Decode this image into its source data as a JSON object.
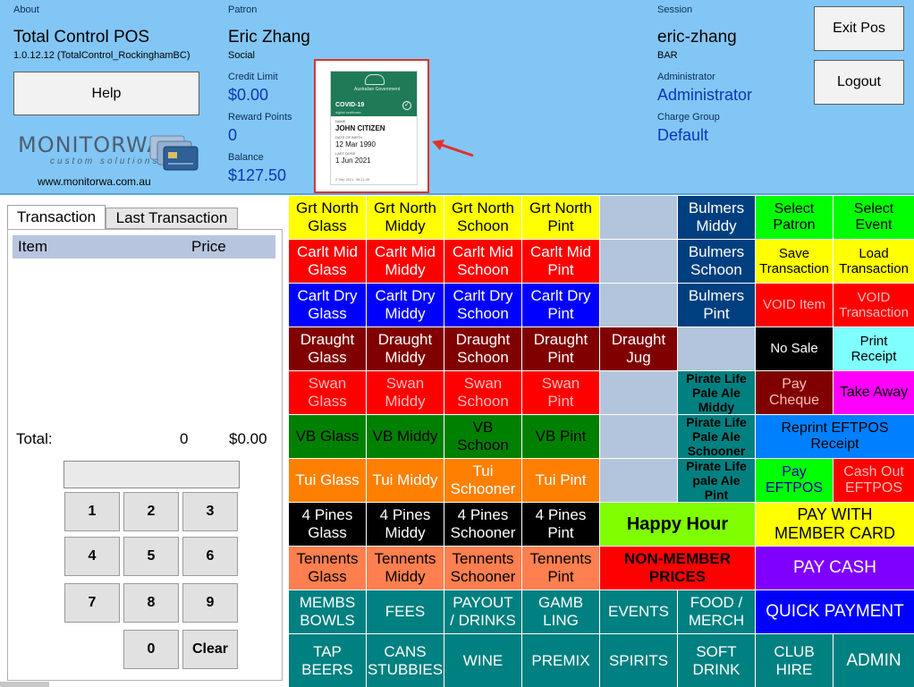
{
  "header": {
    "about_label": "About",
    "app_name": "Total Control POS",
    "version": "1.0.12.12  (TotalControl_RockinghamBC)",
    "help_label": "Help",
    "logo_text": "MONITORWA",
    "logo_sub": "custom solutions",
    "site_url": "www.monitorwa.com.au",
    "patron_label": "Patron",
    "patron_name": "Eric Zhang",
    "patron_type": "Social",
    "credit_limit_label": "Credit Limit",
    "credit_limit": "$0.00",
    "reward_points_label": "Reward Points",
    "reward_points": "0",
    "balance_label": "Balance",
    "balance": "$127.50",
    "session_label": "Session",
    "session_user": "eric-zhang",
    "session_location": "BAR",
    "administrator_label": "Administrator",
    "administrator": "Administrator",
    "charge_group_label": "Charge Group",
    "charge_group": "Default",
    "exit_pos_label": "Exit Pos",
    "logout_label": "Logout"
  },
  "id_card": {
    "gov_text": "Australian Government",
    "title": "COVID-19",
    "subtitle": "digital certificate",
    "name_label": "NAME",
    "name": "JOHN CITIZEN",
    "dob_label": "DATE OF BIRTH",
    "dob": "12 Mar 1990",
    "last_dose_label": "LAST DOSE",
    "last_dose": "1 Jun 2021",
    "footer": "2 Sep 2021, 08:21:39"
  },
  "transaction": {
    "tabs": [
      "Transaction",
      "Last Transaction"
    ],
    "col_item": "Item",
    "col_price": "Price",
    "total_label": "Total:",
    "total_qty": "0",
    "total_value": "$0.00",
    "keys": [
      "1",
      "2",
      "3",
      "4",
      "5",
      "6",
      "7",
      "8",
      "9",
      "0",
      "Clear"
    ]
  },
  "colors": {
    "yellow": "#ffff00",
    "red": "#ff0000",
    "blue": "#0000ff",
    "maroon": "#800000",
    "green": "#008000",
    "orange": "#ff8000",
    "black": "#000000",
    "salmon": "#ff7f50",
    "teal": "#008080",
    "navy": "#003f7f",
    "empty": "#b3c5dc",
    "lime": "#7fff00",
    "bright_green": "#00ff00",
    "cyan": "#7fffff",
    "magenta": "#ff00ff",
    "purple": "#8000ff",
    "royal": "#0000ff",
    "sky": "#0080ff"
  },
  "grid": {
    "rows": [
      [
        "Grt North\nGlass",
        "Grt North\nMiddy",
        "Grt North\nSchoon",
        "Grt North\nPint",
        "",
        "Bulmers\nMiddy",
        "Select\nPatron",
        "Select\nEvent"
      ],
      [
        "Carlt Mid\nGlass",
        "Carlt Mid\nMiddy",
        "Carlt Mid\nSchoon",
        "Carlt Mid\nPint",
        "",
        "Bulmers\nSchoon",
        "Save\nTransaction",
        "Load\nTransaction"
      ],
      [
        "Carlt Dry\nGlass",
        "Carlt Dry\nMiddy",
        "Carlt Dry\nSchoon",
        "Carlt Dry\nPint",
        "",
        "Bulmers\nPint",
        "VOID Item",
        "VOID\nTransaction"
      ],
      [
        "Draught\nGlass",
        "Draught\nMiddy",
        "Draught\nSchoon",
        "Draught\nPint",
        "Draught\nJug",
        "",
        "No Sale",
        "Print\nReceipt"
      ],
      [
        "Swan\nGlass",
        "Swan\nMiddy",
        "Swan\nSchoon",
        "Swan\nPint",
        "",
        "Pirate Life\nPale Ale\nMiddy",
        "Pay\nCheque",
        "Take Away"
      ],
      [
        "VB Glass",
        "VB Middy",
        "VB\nSchoon",
        "VB Pint",
        "",
        "Pirate Life\nPale Ale\nSchooner",
        "Reprint EFTPOS\nReceipt"
      ],
      [
        "Tui Glass",
        "Tui Middy",
        "Tui\nSchooner",
        "Tui Pint",
        "",
        "Pirate Life\npale Ale\nPint",
        "Pay\nEFTPOS",
        "Cash Out\nEFTPOS"
      ],
      [
        "4 Pines\nGlass",
        "4 Pines\nMiddy",
        "4 Pines\nSchooner",
        "4 Pines\nPint",
        "Happy Hour",
        "PAY WITH\nMEMBER CARD"
      ],
      [
        "Tennents\nGlass",
        "Tennents\nMiddy",
        "Tennents\nSchooner",
        "Tennents\nPint",
        "NON-MEMBER\nPRICES",
        "PAY CASH"
      ],
      [
        "MEMBS\nBOWLS",
        "FEES",
        "PAYOUT\n/ DRINKS",
        "GAMB\nLING",
        "EVENTS",
        "FOOD /\nMERCH",
        "QUICK PAYMENT"
      ],
      [
        "TAP\nBEERS",
        "CANS\nSTUBBIES",
        "WINE",
        "PREMIX",
        "SPIRITS",
        "SOFT\nDRINK",
        "CLUB\nHIRE",
        "ADMIN"
      ]
    ]
  }
}
